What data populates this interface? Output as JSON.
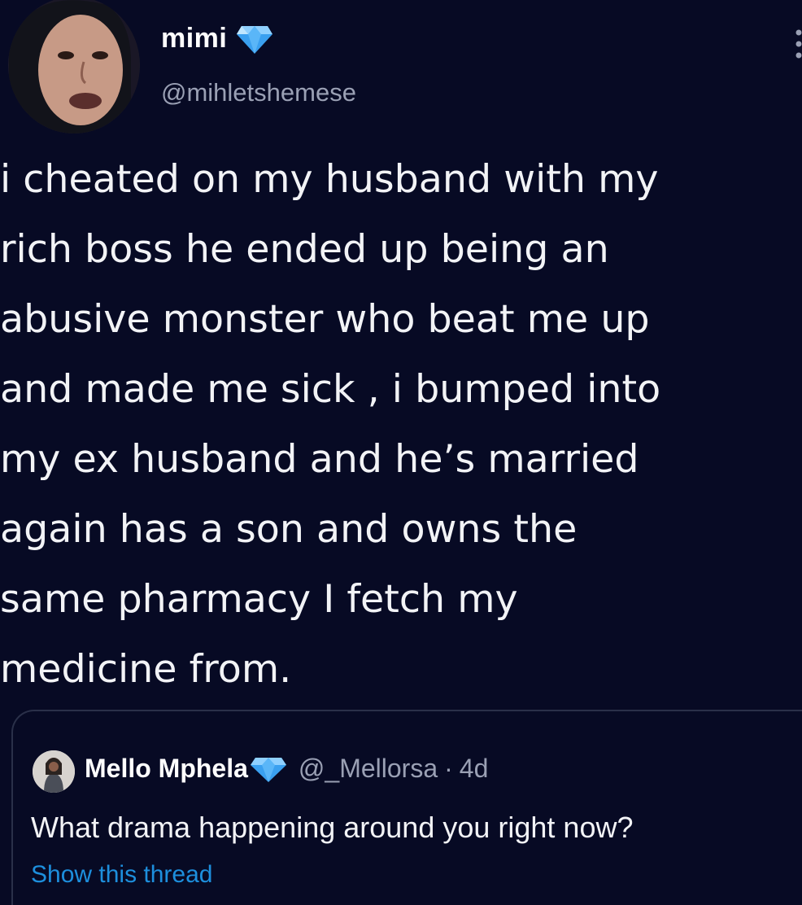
{
  "colors": {
    "background": "#070a24",
    "text": "#f2f3f6",
    "secondary_text": "#9aa0b4",
    "verified_badge": "#3aa0f0",
    "link": "#1d8fdd",
    "card_border": "#2a3049"
  },
  "tweet": {
    "author": {
      "display_name": "mimi",
      "verified_icon": "verified-diamond-icon",
      "handle": "@mihletshemese"
    },
    "more_icon": "more-options-icon",
    "text": "i cheated on my husband with my\nrich boss he ended up being an\nabusive monster who beat me up\nand made me sick , i bumped into\nmy ex husband and he’s married\nagain has a son and owns the\nsame pharmacy I fetch my\nmedicine from."
  },
  "quoted_tweet": {
    "author": {
      "display_name": "Mello Mphela",
      "verified_icon": "verified-diamond-icon",
      "handle": "@_Mellorsa",
      "separator": "·",
      "timestamp": "4d"
    },
    "text": "What drama happening around you right now?",
    "show_thread_label": "Show this thread"
  }
}
